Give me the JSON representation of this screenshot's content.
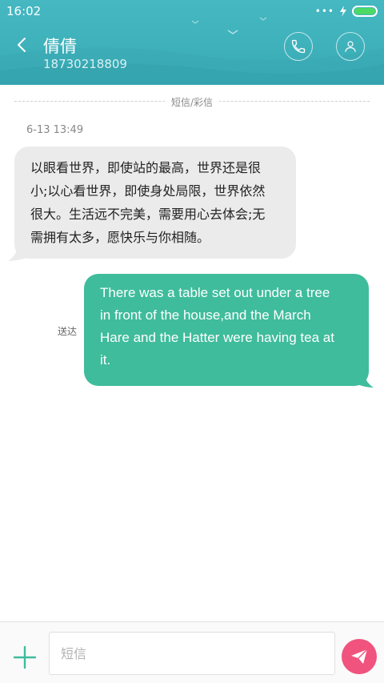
{
  "status_bar": {
    "time": "16:02",
    "dots": "•••"
  },
  "header": {
    "contact_name": "倩倩",
    "phone_number": "18730218809"
  },
  "divider": {
    "label": "短信/彩信"
  },
  "messages": [
    {
      "direction": "incoming",
      "timestamp": "6-13 13:49",
      "lines": [
        "以眼看世界，即使站的最高，世界还是很",
        "小;以心看世界，即使身处局限，世界依然",
        "很大。生活远不完美，需要用心去体会;无",
        "需拥有太多，愿快乐与你相随。"
      ]
    },
    {
      "direction": "outgoing",
      "status": "送达",
      "lines": [
        "There was a table set out under a tree",
        "in front of the house,and the March",
        "Hare and the Hatter were having tea at",
        "it."
      ]
    }
  ],
  "composer": {
    "placeholder": "短信"
  },
  "colors": {
    "header": "#3fb1bb",
    "outgoing_bubble": "#3fbc9c",
    "incoming_bubble": "#ebebeb",
    "send_button": "#f0537e",
    "add_icon": "#3fbc9c"
  },
  "icons": {
    "back": "chevron-left-icon",
    "call": "phone-icon",
    "contact": "person-icon",
    "add": "plus-icon",
    "send": "paper-plane-icon"
  }
}
